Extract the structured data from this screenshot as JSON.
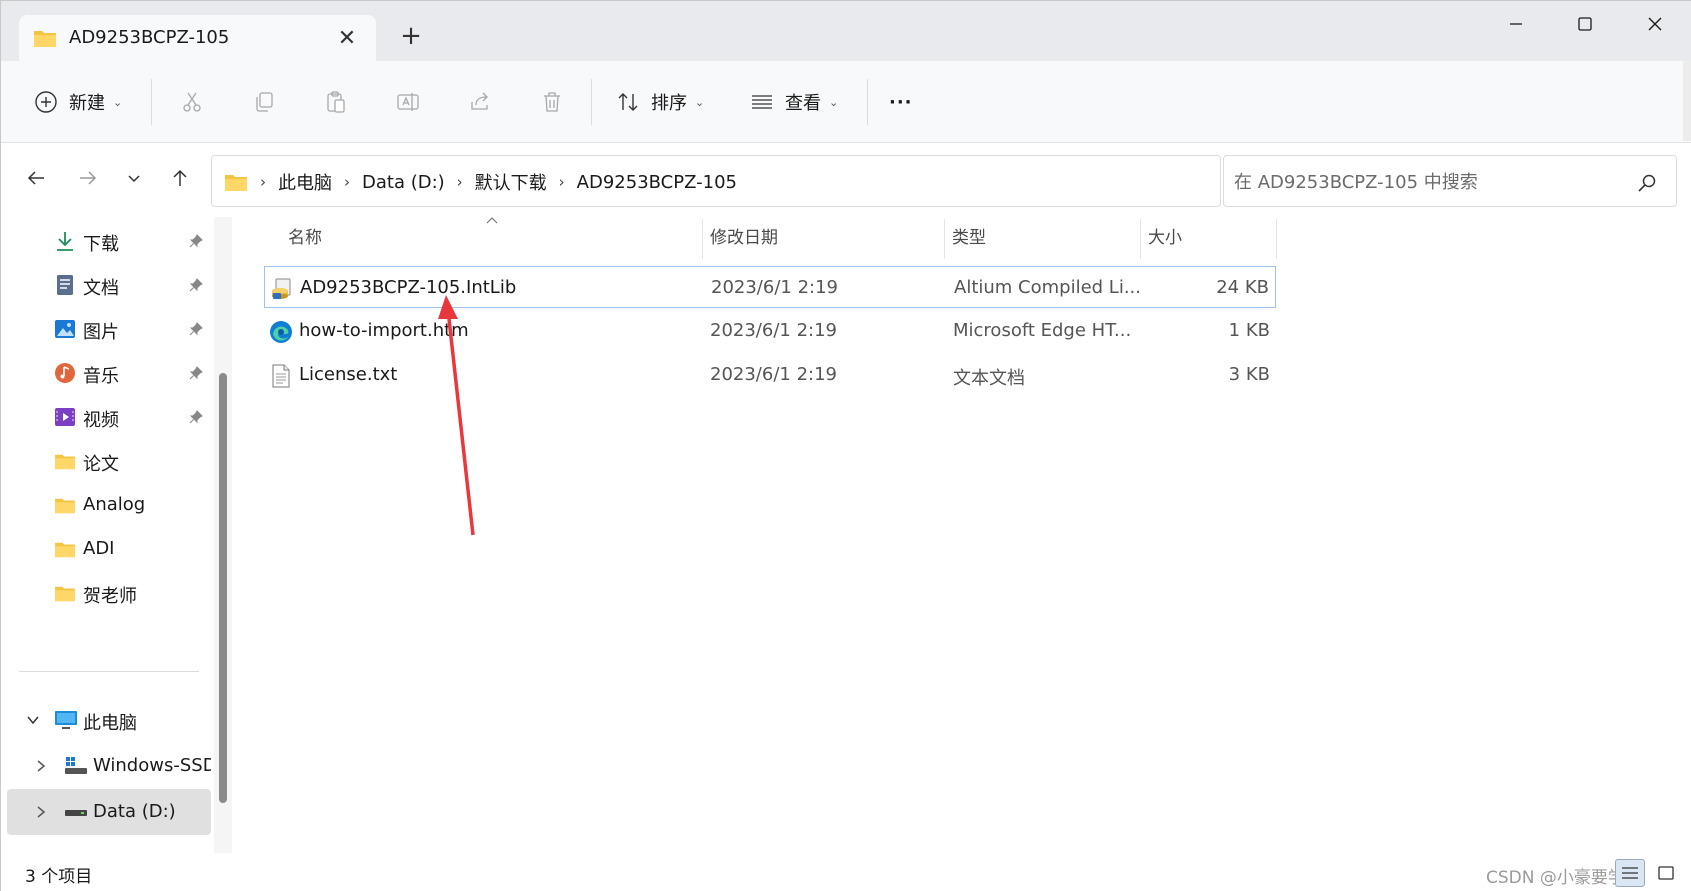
{
  "window": {
    "tab_title": "AD9253BCPZ-105",
    "new_tab_symbol": "+",
    "close_tab_symbol": "✕"
  },
  "toolbar": {
    "new_label": "新建",
    "sort_label": "排序",
    "view_label": "查看",
    "more_label": "···"
  },
  "address": {
    "crumbs": [
      "此电脑",
      "Data (D:)",
      "默认下载",
      "AD9253BCPZ-105"
    ],
    "search_placeholder": "在 AD9253BCPZ-105 中搜索"
  },
  "sidebar": {
    "quick_access": [
      {
        "label": "下载",
        "icon": "download-icon",
        "pinned": true
      },
      {
        "label": "文档",
        "icon": "document-icon",
        "pinned": true
      },
      {
        "label": "图片",
        "icon": "pictures-icon",
        "pinned": true
      },
      {
        "label": "音乐",
        "icon": "music-icon",
        "pinned": true
      },
      {
        "label": "视频",
        "icon": "video-icon",
        "pinned": true
      },
      {
        "label": "论文",
        "icon": "folder-icon",
        "pinned": false
      },
      {
        "label": "Analog",
        "icon": "folder-icon",
        "pinned": false
      },
      {
        "label": "ADI",
        "icon": "folder-icon",
        "pinned": false
      },
      {
        "label": "贺老师",
        "icon": "folder-icon",
        "pinned": false
      }
    ],
    "tree": [
      {
        "label": "此电脑",
        "icon": "computer-icon",
        "expanded": true
      },
      {
        "label": "Windows-SSD",
        "icon": "drive-icon",
        "expanded": false
      },
      {
        "label": "Data (D:)",
        "icon": "drive-icon",
        "expanded": false,
        "selected": true
      }
    ]
  },
  "columns": {
    "name": "名称",
    "modified": "修改日期",
    "type": "类型",
    "size": "大小"
  },
  "files": [
    {
      "name": "AD9253BCPZ-105.IntLib",
      "modified": "2023/6/1 2:19",
      "type": "Altium Compiled Li...",
      "size": "24 KB",
      "icon": "intlib-icon",
      "selected": true
    },
    {
      "name": "how-to-import.htm",
      "modified": "2023/6/1 2:19",
      "type": "Microsoft Edge HT...",
      "size": "1 KB",
      "icon": "edge-icon",
      "selected": false
    },
    {
      "name": "License.txt",
      "modified": "2023/6/1 2:19",
      "type": "文本文档",
      "size": "3 KB",
      "icon": "text-file-icon",
      "selected": false
    }
  ],
  "status": {
    "count_text": "3 个项目",
    "watermark": "CSDN @小豪要学习"
  },
  "colors": {
    "accent": "#0067c0",
    "selection_border": "#9ec3ec",
    "annotation_arrow": "#e8383d",
    "folder_yellow": "#f4c542"
  }
}
